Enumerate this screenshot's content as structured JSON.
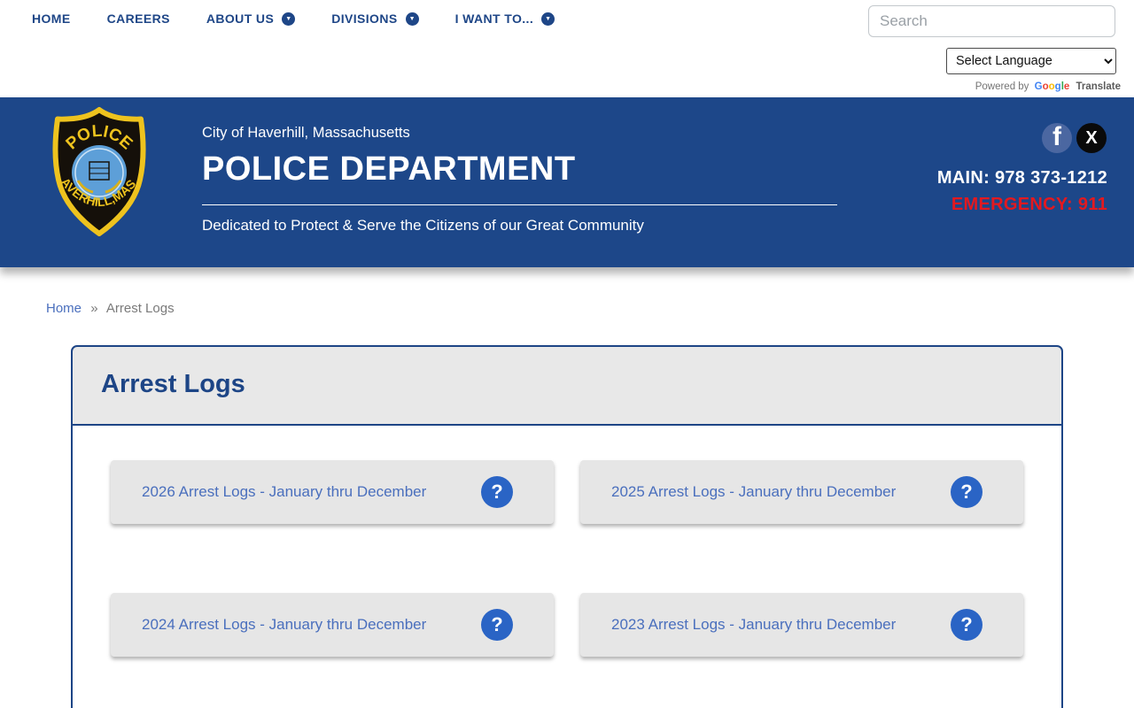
{
  "nav": {
    "items": [
      {
        "label": "HOME",
        "has_dropdown": false
      },
      {
        "label": "CAREERS",
        "has_dropdown": false
      },
      {
        "label": "ABOUT US",
        "has_dropdown": true
      },
      {
        "label": "DIVISIONS",
        "has_dropdown": true
      },
      {
        "label": "I WANT TO...",
        "has_dropdown": true
      }
    ],
    "search_placeholder": "Search",
    "language_selected": "Select Language",
    "translate": {
      "powered_by": "Powered by",
      "brand": "Google",
      "label": "Translate"
    }
  },
  "header": {
    "city": "City of Haverhill, Massachusetts",
    "title": "POLICE DEPARTMENT",
    "tagline": "Dedicated to Protect & Serve the Citizens of our Great Community",
    "main_phone": "MAIN: 978 373-1212",
    "emergency": "EMERGENCY: 911",
    "badge": {
      "top": "POLICE",
      "bottom": "HAVERHILL,MASS."
    }
  },
  "breadcrumb": {
    "home": "Home",
    "separator": "»",
    "current": "Arrest Logs"
  },
  "main": {
    "title": "Arrest Logs",
    "cards": [
      {
        "label": "2026 Arrest Logs - January thru December"
      },
      {
        "label": "2025 Arrest Logs - January thru December"
      },
      {
        "label": "2024 Arrest Logs - January thru December"
      },
      {
        "label": "2023 Arrest Logs - January thru December"
      }
    ]
  },
  "icons": {
    "chevron": "▼",
    "facebook": "f",
    "x": "X",
    "help": "?"
  },
  "colors": {
    "header_blue": "#1d4789",
    "nav_blue": "#1e4687",
    "panel_border_navy": "#1d4586",
    "link_blue": "#4a6fbd",
    "help_icon_blue": "#2a64c5",
    "emergency_red": "#e3191f",
    "badge_gold": "#eec31e",
    "card_gray": "#e6e6e6"
  }
}
